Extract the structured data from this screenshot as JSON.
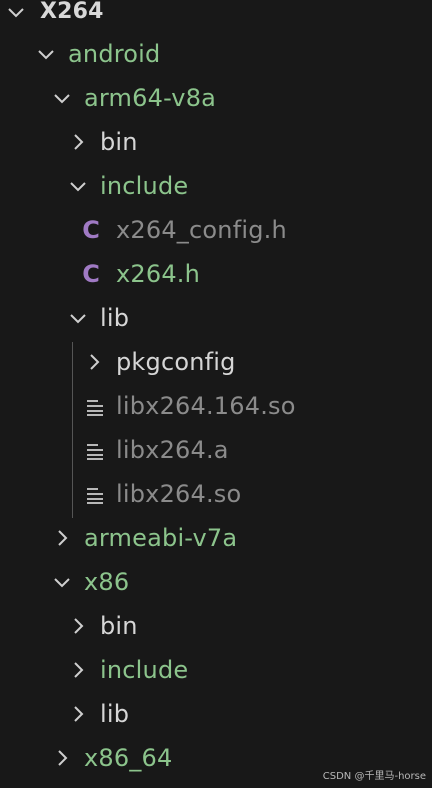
{
  "tree": {
    "root": {
      "label": "X264",
      "expanded": true
    },
    "items": [
      {
        "label": "android",
        "expanded": true
      },
      {
        "label": "arm64-v8a",
        "expanded": true
      },
      {
        "label": "bin",
        "expanded": false
      },
      {
        "label": "include",
        "expanded": true
      },
      {
        "label": "x264_config.h",
        "icon": "c-file-icon"
      },
      {
        "label": "x264.h",
        "icon": "c-file-icon"
      },
      {
        "label": "lib",
        "expanded": true
      },
      {
        "label": "pkgconfig",
        "expanded": false
      },
      {
        "label": "libx264.164.so",
        "icon": "lines-file-icon"
      },
      {
        "label": "libx264.a",
        "icon": "lines-file-icon"
      },
      {
        "label": "libx264.so",
        "icon": "lines-file-icon"
      },
      {
        "label": "armeabi-v7a",
        "expanded": false
      },
      {
        "label": "x86",
        "expanded": true
      },
      {
        "label": "bin",
        "expanded": false
      },
      {
        "label": "include",
        "expanded": false
      },
      {
        "label": "lib",
        "expanded": false
      },
      {
        "label": "x86_64",
        "expanded": false
      }
    ]
  },
  "watermark": "CSDN @千里马-horse",
  "colors": {
    "background": "#181818",
    "green_label": "#8cc48c",
    "plain_label": "#d6d6d6",
    "dim_label": "#8b8b8b",
    "c_icon": "#a07ac4",
    "guide_line": "#555555"
  }
}
